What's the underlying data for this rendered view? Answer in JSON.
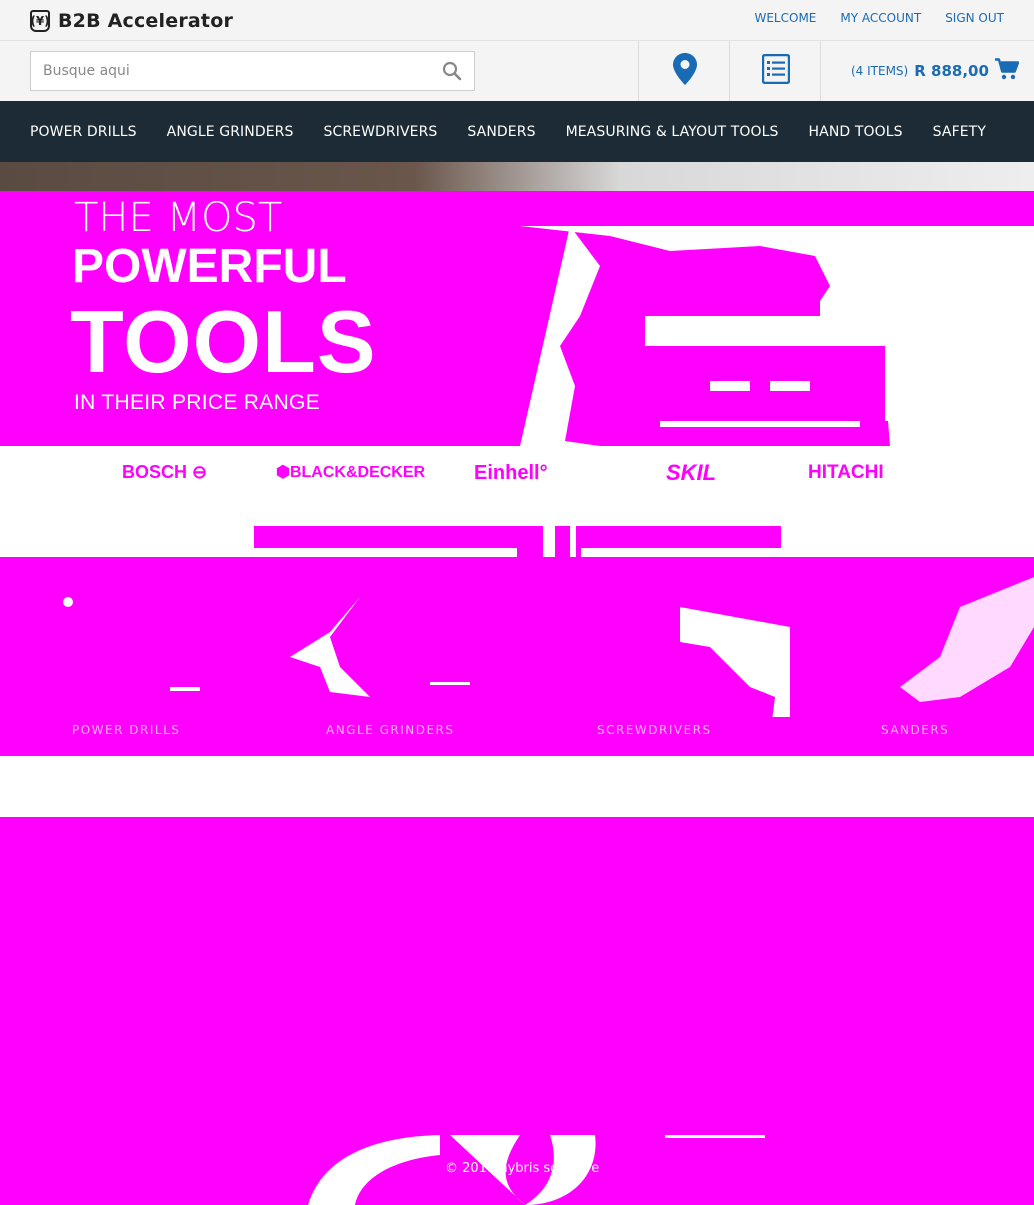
{
  "brand": {
    "logo_glyph": "(¥)",
    "name": "B2B Accelerator"
  },
  "top_links": {
    "welcome": "WELCOME",
    "my_account": "MY ACCOUNT",
    "sign_out": "SIGN OUT"
  },
  "search": {
    "placeholder": "Busque aqui",
    "value": ""
  },
  "cart": {
    "count_label": "(4 ITEMS)",
    "total": "R 888,00"
  },
  "nav": {
    "items": [
      {
        "label": "POWER DRILLS"
      },
      {
        "label": "ANGLE GRINDERS"
      },
      {
        "label": "SCREWDRIVERS"
      },
      {
        "label": "SANDERS"
      },
      {
        "label": "MEASURING & LAYOUT TOOLS"
      },
      {
        "label": "HAND TOOLS"
      },
      {
        "label": "SAFETY"
      }
    ]
  },
  "hero": {
    "line1": "THE MOST",
    "line2": "POWERFUL",
    "line3": "TOOLS",
    "line4": "IN THEIR PRICE RANGE"
  },
  "brands": {
    "items": [
      {
        "label": "BOSCH ⊖"
      },
      {
        "label": "⬢BLACK&DECKER"
      },
      {
        "label": "Einhell°"
      },
      {
        "label": "SKIL"
      },
      {
        "label": "HITACHI"
      }
    ]
  },
  "categories": {
    "items": [
      {
        "label": "POWER DRILLS"
      },
      {
        "label": "ANGLE GRINDERS"
      },
      {
        "label": "SCREWDRIVERS"
      },
      {
        "label": "SANDERS"
      }
    ]
  },
  "footer": {
    "copyright": "© 2018 hybris software"
  },
  "colors": {
    "nav_bg": "#1c2b36",
    "link": "#1a6bb5",
    "placeholder_magenta": "#ff00ff",
    "top_bg": "#f4f4f4"
  },
  "icons": {
    "search": "search-icon",
    "location": "location-pin-icon",
    "list": "list-icon",
    "cart": "cart-icon"
  }
}
